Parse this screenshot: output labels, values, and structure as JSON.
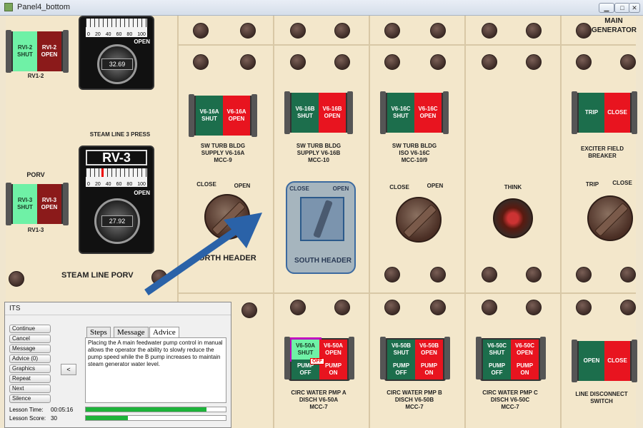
{
  "window": {
    "title": "Panel4_bottom"
  },
  "valves_top": {
    "rvi2": {
      "shut": "RVI-2\nSHUT",
      "open": "RVI-2\nOPEN",
      "label": "RV1-2"
    },
    "rvi3": {
      "shut": "RVI-3\nSHUT",
      "open": "RVI-3\nOPEN",
      "label": "RV1-3"
    }
  },
  "gauges": {
    "top": {
      "scale": [
        "0",
        "20",
        "40",
        "60",
        "80",
        "100"
      ],
      "open": "OPEN",
      "readout": "32.69"
    },
    "rv3": {
      "title": "RV-3",
      "scale": [
        "0",
        "20",
        "40",
        "60",
        "80",
        "100"
      ],
      "open": "OPEN",
      "readout": "27.92"
    }
  },
  "labels": {
    "steam_line_press": "STEAM LINE 3 PRESS",
    "porv": "PORV",
    "steam_line_porv": "STEAM LINE PORV",
    "north_header": "ORTH HEADER",
    "south_header": "SOUTH HEADER",
    "main_generator": "MAIN\nGENERATOR",
    "think": "THINK"
  },
  "switches_upper": [
    {
      "shut": "V6-16A\nSHUT",
      "open": "V6-16A\nOPEN",
      "label": "SW TURB BLDG\nSUPPLY V6-16A\nMCC-9"
    },
    {
      "shut": "V6-16B\nSHUT",
      "open": "V6-16B\nOPEN",
      "label": "SW TURB BLDG\nSUPPLY V6-16B\nMCC-10"
    },
    {
      "shut": "V6-16C\nSHUT",
      "open": "V6-16C\nOPEN",
      "label": "SW TURB BLDG\nISO V6-16C\nMCC-10/9"
    },
    {
      "shut": "TRIP",
      "open": "CLOSE",
      "label": "EXCITER FIELD\nBREAKER"
    }
  ],
  "knob_labels": {
    "north": {
      "left": "CLOSE",
      "right": "OPEN"
    },
    "south": {
      "left": "CLOSE",
      "right": "OPEN"
    },
    "third": {
      "left": "CLOSE",
      "right": "OPEN"
    },
    "exciter": {
      "left": "TRIP",
      "right": "CLOSE"
    }
  },
  "switches_lower": [
    {
      "shut": "V6-50A\nSHUT",
      "open": "V6-50A\nOPEN",
      "pump_off": "PUMP\nOFF",
      "pump_on": "PUMP\nON",
      "label": "CIRC WATER PMP A\nDISCH V6-50A\nMCC-7",
      "flag": "OFF"
    },
    {
      "shut": "V6-50B\nSHUT",
      "open": "V6-50B\nOPEN",
      "pump_off": "PUMP\nOFF",
      "pump_on": "PUMP\nON",
      "label": "CIRC WATER PMP B\nDISCH V6-50B\nMCC-7"
    },
    {
      "shut": "V6-50C\nSHUT",
      "open": "V6-50C\nOPEN",
      "pump_off": "PUMP\nOFF",
      "pump_on": "PUMP\nON",
      "label": "CIRC WATER PMP C\nDISCH V6-50C\nMCC-7"
    },
    {
      "shut": "OPEN",
      "open": "CLOSE",
      "label": "LINE DISCONNECT\nSWITCH"
    }
  ],
  "its": {
    "title": "ITS",
    "buttons": [
      "Continue",
      "Cancel",
      "Message",
      "Advice (0)",
      "Graphics",
      "Repeat",
      "Next",
      "Silence"
    ],
    "back_button": "<",
    "tabs": [
      "Steps",
      "Message",
      "Advice"
    ],
    "advice_text": "Placing the A main feedwater pump control in manual allows the operator the ability to slowly reduce the pump speed while the B pump increases to maintain steam generator water level.",
    "lesson_time_label": "Lesson Time:",
    "lesson_time": "00:05:16",
    "lesson_score_label": "Lesson Score:",
    "lesson_score": "30",
    "progress_time": 0.86,
    "progress_score": 0.3
  },
  "colors": {
    "panel": "#f3e7cb",
    "switch_green": "#1c6e4c",
    "switch_red": "#e8141f",
    "highlight": "#4a78b0",
    "arrow": "#2a62a8"
  }
}
